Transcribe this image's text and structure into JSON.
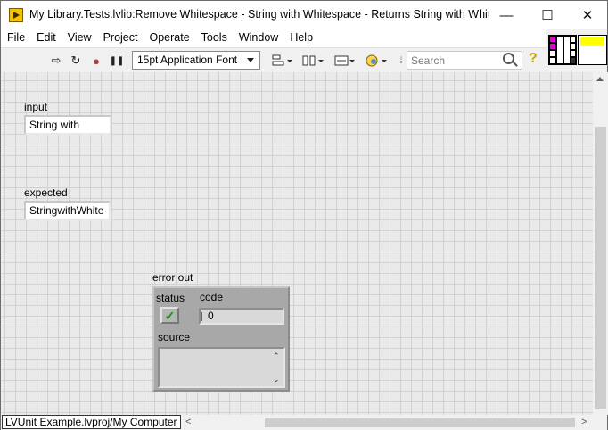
{
  "window": {
    "title": "My Library.Tests.lvlib:Remove Whitespace - String with Whitespace - Returns String with Whites...",
    "minimize_glyph": "—",
    "maximize_glyph": "☐",
    "close_glyph": "✕"
  },
  "menu": [
    "File",
    "Edit",
    "View",
    "Project",
    "Operate",
    "Tools",
    "Window",
    "Help"
  ],
  "toolbar": {
    "font": "15pt Application Font",
    "search_placeholder": "Search",
    "run_glyph": "⇨",
    "run_continuously_glyph": "↻",
    "abort_glyph": "●",
    "pause_glyph": "❚❚",
    "help_glyph": "?"
  },
  "front_panel": {
    "input": {
      "label": "input",
      "value": "String with"
    },
    "expected": {
      "label": "expected",
      "value": "StringwithWhite"
    },
    "error_out": {
      "label": "error out",
      "status_label": "status",
      "code_label": "code",
      "code_value": "0",
      "source_label": "source",
      "source_value": "",
      "status_glyph": "✓"
    }
  },
  "statusbar": {
    "context": "LVUnit Example.lvproj/My Computer"
  },
  "colors": {
    "canvas": "#eaeaea",
    "grid": "#d2d2d2",
    "cluster": "#a8a8a8",
    "status_ok": "#119911"
  }
}
